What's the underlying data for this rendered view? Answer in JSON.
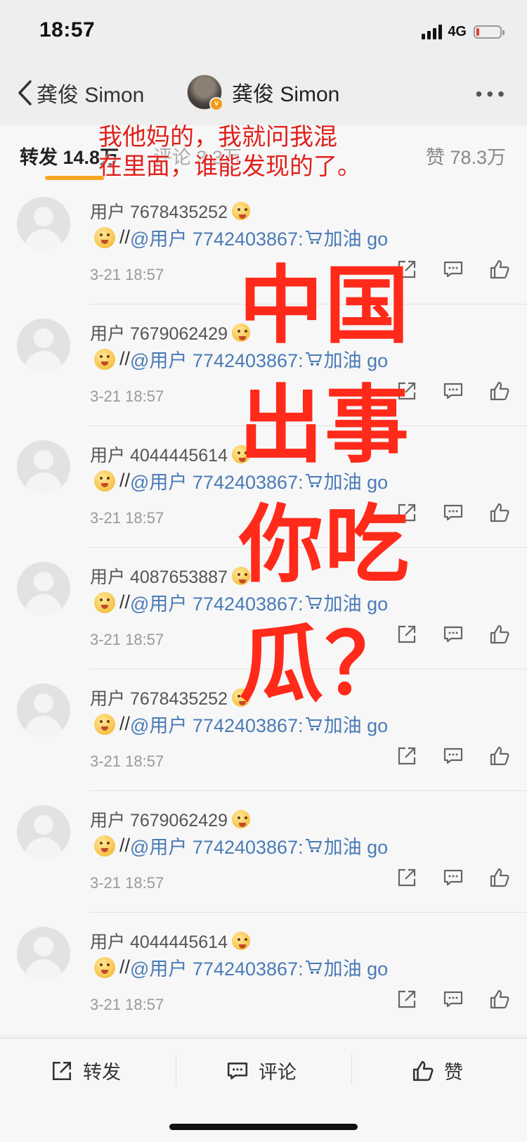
{
  "status_bar": {
    "time": "18:57",
    "network": "4G"
  },
  "nav": {
    "back_label": "龚俊 Simon",
    "title": "龚俊 Simon",
    "more": "•••"
  },
  "tabs": {
    "repost": "转发 14.8万",
    "comment": "评论 3.3万",
    "like": "赞 78.3万"
  },
  "overlay": {
    "caption_lines": [
      "我他妈的，我就问我混",
      "在里面，谁能发现的了。"
    ],
    "big_lines": [
      "中国",
      "出事",
      "你吃",
      "瓜？"
    ]
  },
  "items": [
    {
      "user": "用户 7678435252",
      "slash": "//",
      "mention": "@用户 7742403867:",
      "text": "加油 go",
      "time": "3-21 18:57"
    },
    {
      "user": "用户 7679062429",
      "slash": "//",
      "mention": "@用户 7742403867:",
      "text": "加油 go",
      "time": "3-21 18:57"
    },
    {
      "user": "用户 4044445614",
      "slash": "//",
      "mention": "@用户 7742403867:",
      "text": "加油 go",
      "time": "3-21 18:57"
    },
    {
      "user": "用户 4087653887",
      "slash": "//",
      "mention": "@用户 7742403867:",
      "text": "加油 go",
      "time": "3-21 18:57"
    },
    {
      "user": "用户 7678435252",
      "slash": "//",
      "mention": "@用户 7742403867:",
      "text": "加油 go",
      "time": "3-21 18:57"
    },
    {
      "user": "用户 7679062429",
      "slash": "//",
      "mention": "@用户 7742403867:",
      "text": "加油 go",
      "time": "3-21 18:57"
    },
    {
      "user": "用户 4044445614",
      "slash": "//",
      "mention": "@用户 7742403867:",
      "text": "加油 go",
      "time": "3-21 18:57"
    }
  ],
  "bottom_bar": {
    "repost": "转发",
    "comment": "评论",
    "like": "赞"
  },
  "colors": {
    "accent": "#f6a623",
    "mention": "#4a7bb7",
    "overlay_red": "#ff2a1a"
  },
  "icons": [
    "back-chevron-icon",
    "signal-icon",
    "battery-icon",
    "share-icon",
    "comment-icon",
    "like-icon",
    "cart-icon",
    "emoji-icon"
  ]
}
